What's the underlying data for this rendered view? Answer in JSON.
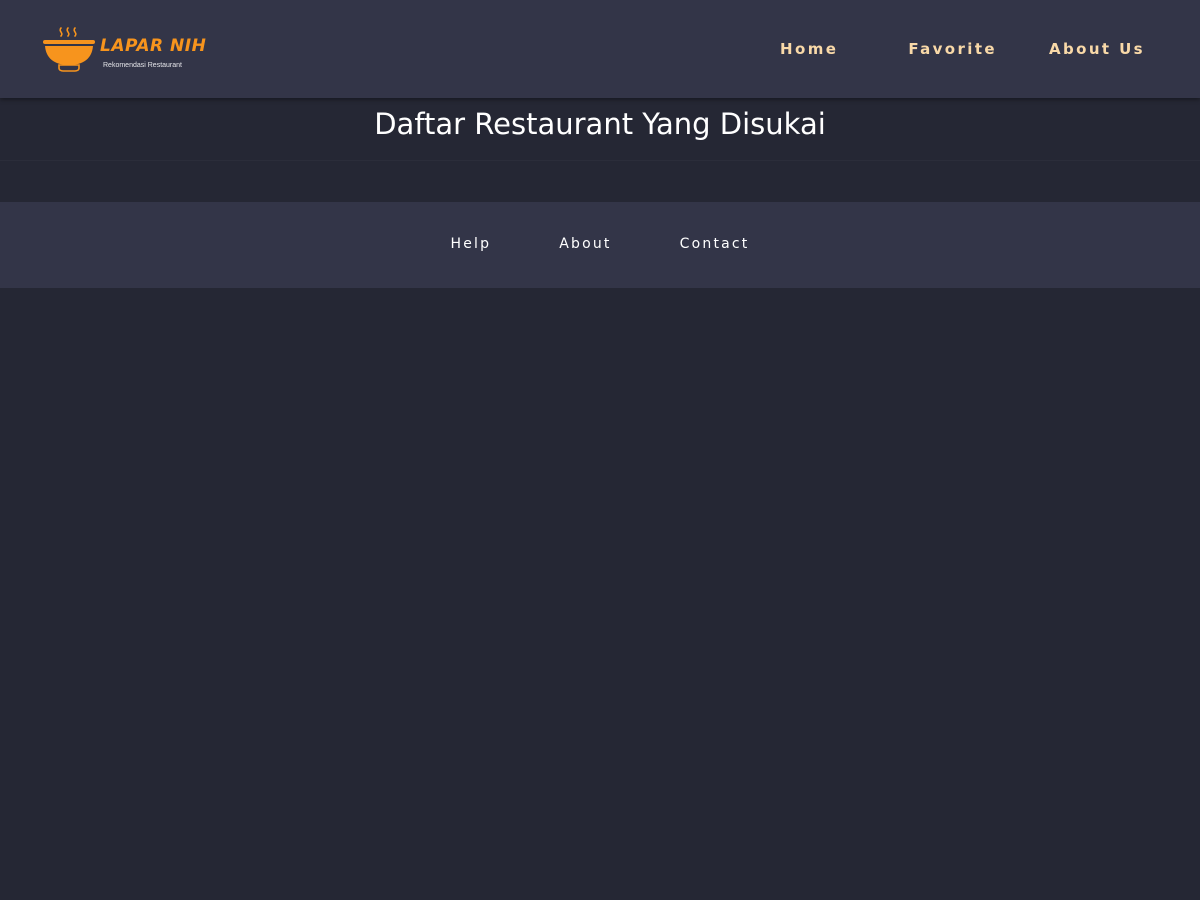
{
  "header": {
    "brand": {
      "name": "LAPAR NIH",
      "tagline": "Rekomendasi Restaurant",
      "logo_icon": "steaming-bowl-icon"
    },
    "nav": [
      {
        "label": "Home"
      },
      {
        "label": "Favorite"
      },
      {
        "label": "About Us"
      }
    ]
  },
  "main": {
    "title": "Daftar Restaurant Yang Disukai"
  },
  "footer": {
    "links": [
      {
        "label": "Help"
      },
      {
        "label": "About"
      },
      {
        "label": "Contact"
      }
    ]
  },
  "colors": {
    "background": "#252734",
    "surface": "#333548",
    "accent": "#f7941d",
    "nav_text": "#f9d9a8",
    "text": "#ffffff"
  }
}
